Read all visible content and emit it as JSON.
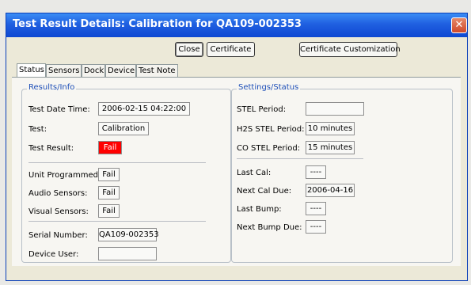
{
  "window": {
    "title": "Test Result Details: Calibration for QA109-002353"
  },
  "toolbar": {
    "close_label": "Close",
    "certificate_label": "Certificate",
    "customization_label": "Certificate Customization"
  },
  "tabs": [
    "Status",
    "Sensors",
    "Dock",
    "Device",
    "Test Note"
  ],
  "results": {
    "legend": "Results/Info",
    "test_date_time_label": "Test Date Time:",
    "test_date_time": "2006-02-15 04:22:00",
    "test_label": "Test:",
    "test": "Calibration",
    "test_result_label": "Test Result:",
    "test_result": "Fail",
    "unit_programmed_label": "Unit Programmed:",
    "unit_programmed": "Fail",
    "audio_sensors_label": "Audio Sensors:",
    "audio_sensors": "Fail",
    "visual_sensors_label": "Visual Sensors:",
    "visual_sensors": "Fail",
    "serial_number_label": "Serial Number:",
    "serial_number": "QA109-002353",
    "device_user_label": "Device User:",
    "device_user": ""
  },
  "settings": {
    "legend": "Settings/Status",
    "stel_period_label": "STEL Period:",
    "stel_period": "",
    "h2s_stel_period_label": "H2S STEL Period:",
    "h2s_stel_period": "10 minutes",
    "co_stel_period_label": "CO STEL Period:",
    "co_stel_period": "15 minutes",
    "last_cal_label": "Last Cal:",
    "last_cal": "----",
    "next_cal_due_label": "Next Cal Due:",
    "next_cal_due": "2006-04-16",
    "last_bump_label": "Last Bump:",
    "last_bump": "----",
    "next_bump_due_label": "Next Bump Due:",
    "next_bump_due": "----"
  },
  "colors": {
    "title_bar": "#1f5fe0",
    "fail_red": "#ff0000",
    "legend_blue": "#1e4fb8"
  }
}
